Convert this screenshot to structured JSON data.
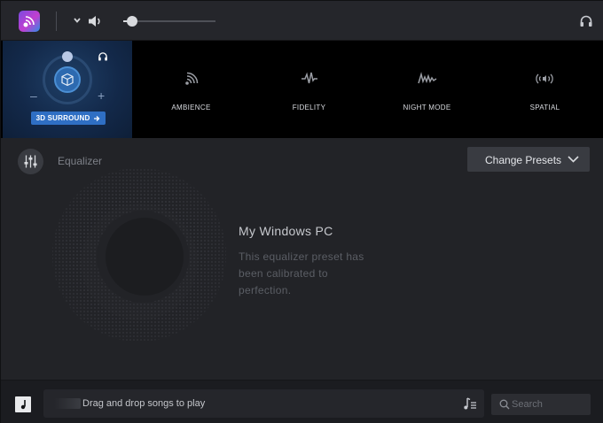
{
  "topbar": {
    "volume_percent": 10
  },
  "surround": {
    "button_label": "3D SURROUND",
    "minus": "–",
    "plus": "+"
  },
  "modes": [
    {
      "label": "AMBIENCE",
      "icon": "ambience-icon"
    },
    {
      "label": "FIDELITY",
      "icon": "fidelity-icon"
    },
    {
      "label": "NIGHT MODE",
      "icon": "night-mode-icon"
    },
    {
      "label": "SPATIAL",
      "icon": "spatial-icon"
    }
  ],
  "equalizer": {
    "label": "Equalizer",
    "preset_button": "Change Presets"
  },
  "device": {
    "title": "My Windows PC",
    "description": "This equalizer preset has been calibrated to perfection."
  },
  "bottom": {
    "drop_text": "Drag and drop songs to play",
    "search_placeholder": "Search"
  },
  "colors": {
    "accent": "#2f6fc4",
    "background": "#222327",
    "mode_bar": "#000000"
  }
}
